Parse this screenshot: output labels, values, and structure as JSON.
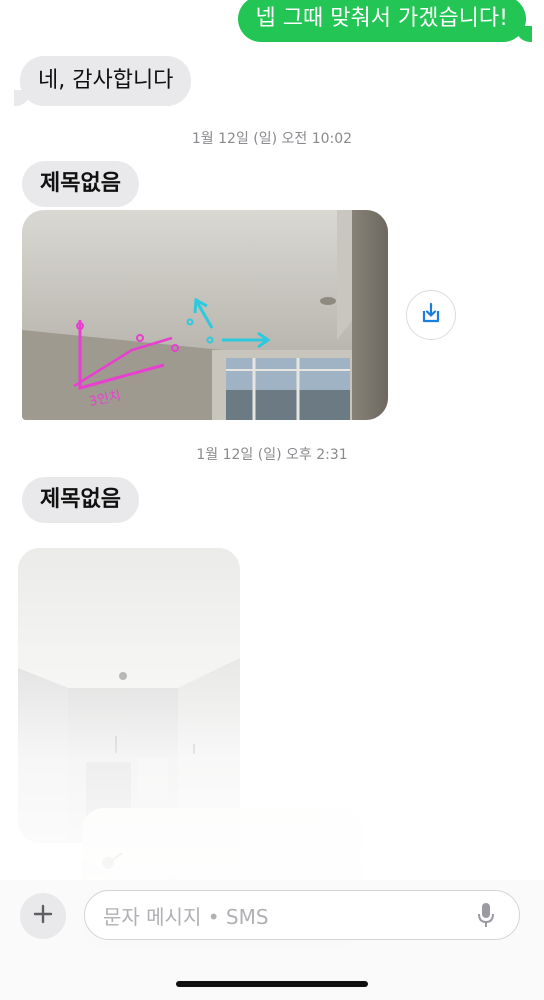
{
  "messages": {
    "outgoing_1": "넵 그때 맞춰서 가겠습니다!",
    "incoming_1": "네, 감사합니다",
    "timestamp_1": "1월 12일 (일) 오전 10:02",
    "subject_1": "제목없음",
    "photo_1_annotation": "3인치",
    "timestamp_2": "1월 12일 (일) 오후 2:31",
    "subject_2": "제목없음"
  },
  "composer": {
    "placeholder": "문자 메시지 • SMS",
    "plus_icon": "plus-icon",
    "mic_icon": "microphone-icon"
  },
  "actions": {
    "save_icon": "download-icon"
  },
  "colors": {
    "outgoing_bubble": "#23c554",
    "incoming_bubble": "#e9e9eb",
    "accent": "#1a7de0",
    "timestamp": "#8a8a8e"
  }
}
